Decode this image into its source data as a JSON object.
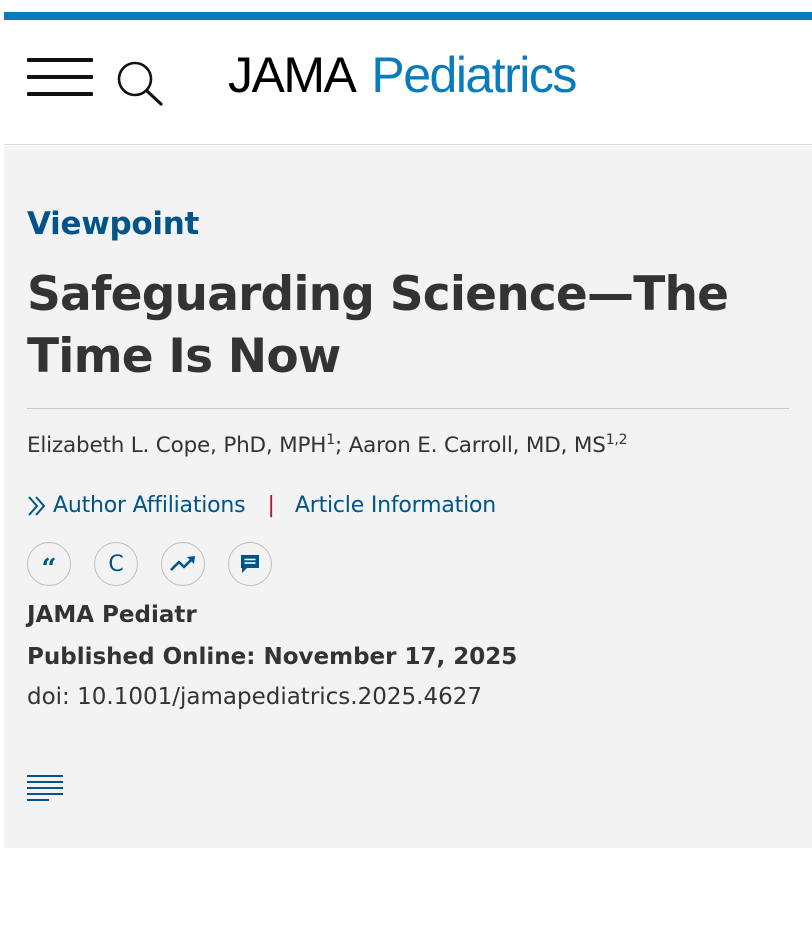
{
  "header": {
    "menu_icon": "hamburger-menu-icon",
    "search_icon": "search-icon",
    "logo": {
      "part1": "JAMA",
      "part2": "Pediatrics",
      "brand_color": "#0a7bbd"
    }
  },
  "article": {
    "type": "Viewpoint",
    "title": "Safeguarding Science—The Time Is Now",
    "authors": [
      {
        "name": "Elizabeth L. Cope, PhD, MPH",
        "affiliations": "1"
      },
      {
        "name": "Aaron E. Carroll, MD, MS",
        "affiliations": "1,2"
      }
    ],
    "author_separator": ";",
    "links": {
      "affiliations_label": "Author Affiliations",
      "separator": "|",
      "info_label": "Article Information"
    },
    "tools": [
      {
        "icon": "cite-quote-icon",
        "glyph": "“"
      },
      {
        "icon": "permissions-icon",
        "glyph": "C"
      },
      {
        "icon": "metrics-trend-icon"
      },
      {
        "icon": "comment-icon"
      }
    ],
    "journal": "JAMA Pediatr",
    "published": "Published Online: November 17, 2025",
    "doi": "doi: 10.1001/jamapediatrics.2025.4627",
    "toc_icon": "table-of-contents-icon"
  },
  "colors": {
    "accent": "#005489",
    "stripe": "#0a7bbd",
    "separator": "#b0162b",
    "panel_bg": "#f3f3f3"
  }
}
